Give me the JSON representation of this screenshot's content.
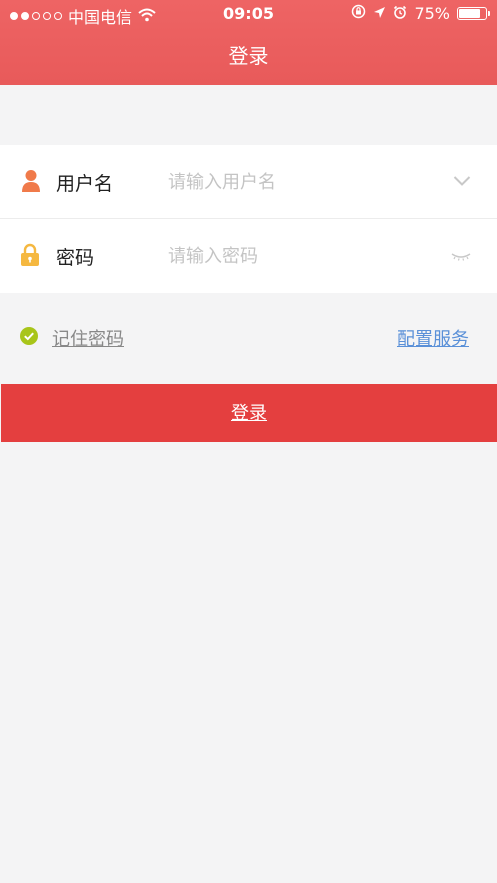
{
  "status_bar": {
    "carrier": "中国电信",
    "time": "09:05",
    "battery": "75%",
    "battery_level": 0.75
  },
  "header": {
    "title": "登录"
  },
  "form": {
    "username": {
      "label": "用户名",
      "placeholder": "请输入用户名",
      "value": ""
    },
    "password": {
      "label": "密码",
      "placeholder": "请输入密码",
      "value": ""
    }
  },
  "options": {
    "remember_label": "记住密码",
    "remember_checked": true,
    "config_label": "配置服务"
  },
  "login_button": {
    "label": "登录"
  },
  "colors": {
    "header": "#e85a5a",
    "button": "#e43f3f",
    "user_icon": "#f07a4a",
    "lock_icon": "#f5b840",
    "check": "#a8c51a",
    "link": "#5a90d8"
  },
  "icons": [
    "wifi-icon",
    "rotation-lock-icon",
    "location-arrow-icon",
    "alarm-icon",
    "battery-icon",
    "user-icon",
    "lock-icon",
    "chevron-down-icon",
    "eye-closed-icon",
    "check-circle-icon"
  ]
}
